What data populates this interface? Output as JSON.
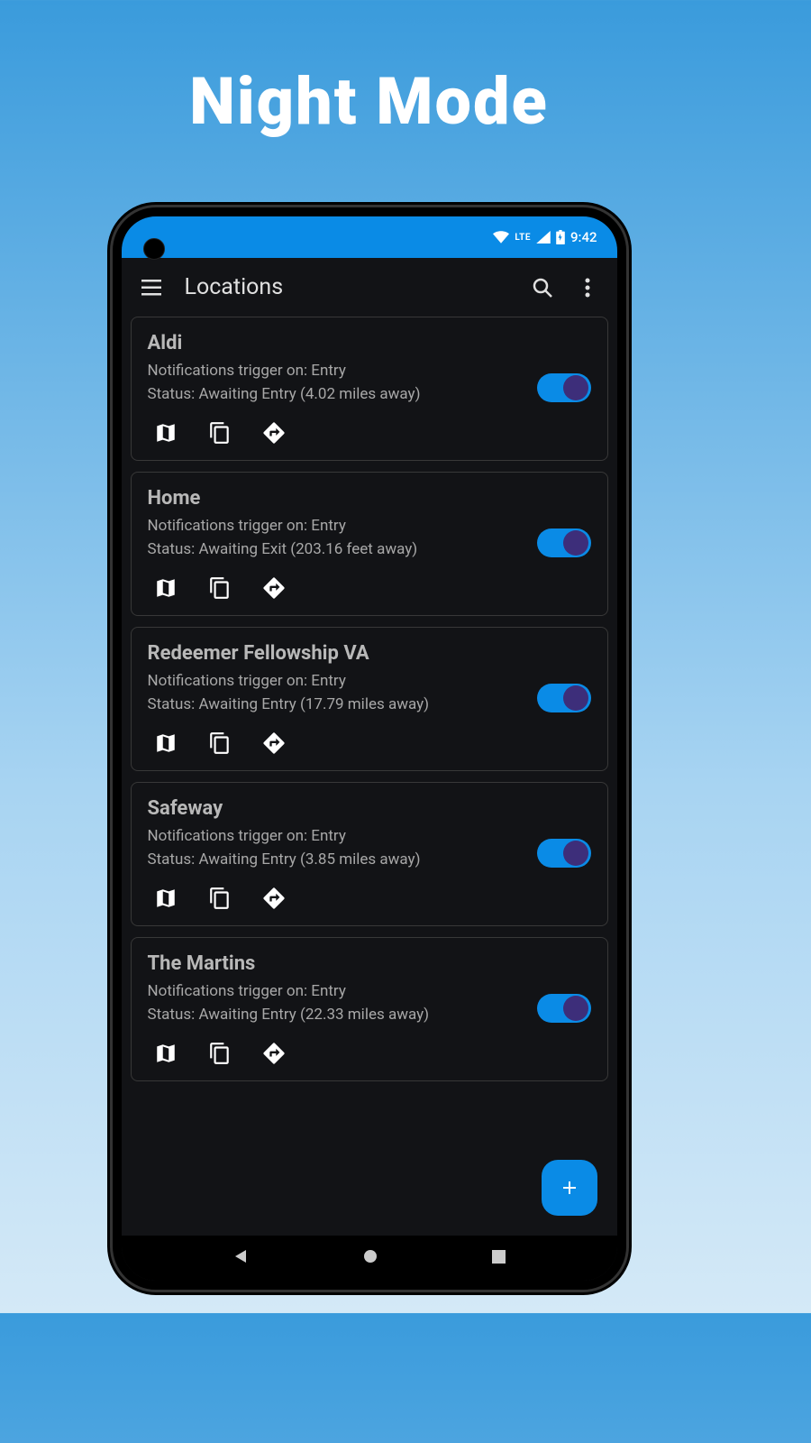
{
  "marketing": {
    "title": "Night Mode"
  },
  "status": {
    "network": "LTE",
    "time": "9:42"
  },
  "appbar": {
    "title": "Locations"
  },
  "locations": [
    {
      "name": "Aldi",
      "trigger": "Notifications trigger on: Entry",
      "status": "Status: Awaiting Entry (4.02 miles away)",
      "enabled": true
    },
    {
      "name": "Home",
      "trigger": "Notifications trigger on: Entry",
      "status": "Status: Awaiting Exit (203.16 feet away)",
      "enabled": true
    },
    {
      "name": "Redeemer Fellowship VA",
      "trigger": "Notifications trigger on: Entry",
      "status": "Status: Awaiting Entry (17.79 miles away)",
      "enabled": true
    },
    {
      "name": "Safeway",
      "trigger": "Notifications trigger on: Entry",
      "status": "Status: Awaiting Entry (3.85 miles away)",
      "enabled": true
    },
    {
      "name": "The Martins",
      "trigger": "Notifications trigger on: Entry",
      "status": "Status: Awaiting Entry (22.33 miles away)",
      "enabled": true
    }
  ]
}
